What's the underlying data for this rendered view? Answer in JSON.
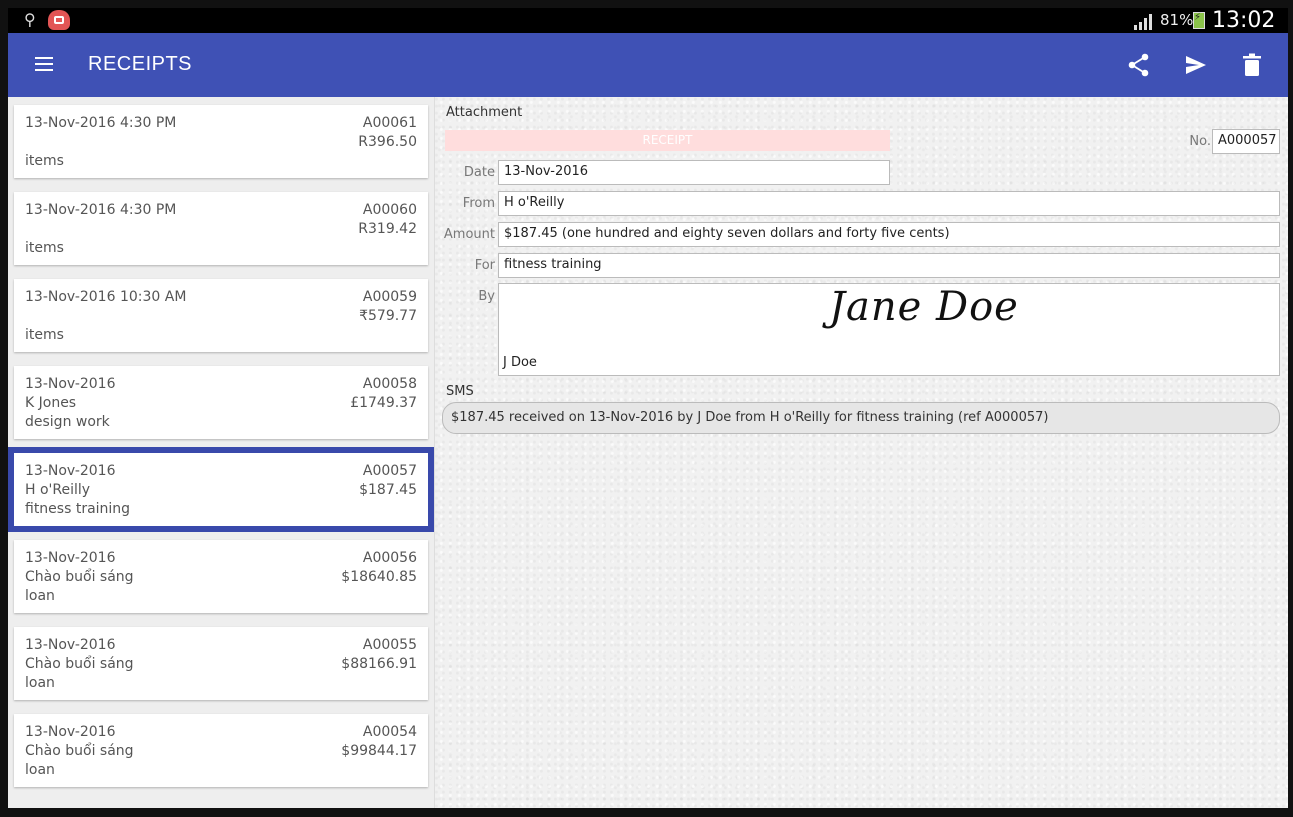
{
  "status_bar": {
    "battery_pct": "81%",
    "time": "13:02"
  },
  "app_bar": {
    "title": "RECEIPTS",
    "actions": [
      "share-icon",
      "send-icon",
      "delete-icon"
    ]
  },
  "receipts": [
    {
      "line1": "13-Nov-2016  4:30 PM",
      "line2": "",
      "line3": "items",
      "ref": "A00061",
      "amount": "R396.50"
    },
    {
      "line1": "13-Nov-2016  4:30 PM",
      "line2": "",
      "line3": "items",
      "ref": "A00060",
      "amount": "R319.42"
    },
    {
      "line1": "13-Nov-2016  10:30 AM",
      "line2": "",
      "line3": "items",
      "ref": "A00059",
      "amount": "₹579.77"
    },
    {
      "line1": "13-Nov-2016",
      "line2": "K Jones",
      "line3": "design work",
      "ref": "A00058",
      "amount": "£1749.37"
    },
    {
      "line1": "13-Nov-2016",
      "line2": "H o'Reilly",
      "line3": "fitness training",
      "ref": "A00057",
      "amount": "$187.45",
      "selected": true
    },
    {
      "line1": "13-Nov-2016",
      "line2": "Chào buổi sáng",
      "line3": "loan",
      "ref": "A00056",
      "amount": "$18640.85"
    },
    {
      "line1": "13-Nov-2016",
      "line2": "Chào buổi sáng",
      "line3": "loan",
      "ref": "A00055",
      "amount": "$88166.91"
    },
    {
      "line1": "13-Nov-2016",
      "line2": "Chào buổi sáng",
      "line3": "loan",
      "ref": "A00054",
      "amount": "$99844.17"
    }
  ],
  "detail": {
    "attachment_label": "Attachment",
    "banner": "RECEIPT",
    "no_label": "No.",
    "no_value": "A000057",
    "date_label": "Date",
    "date_value": "13-Nov-2016",
    "from_label": "From",
    "from_value": "H o'Reilly",
    "amount_label": "Amount",
    "amount_value": "$187.45 (one hundred and eighty seven dollars and forty five cents)",
    "for_label": "For",
    "for_value": "fitness training",
    "by_label": "By",
    "signature_script": "Jane Doe",
    "signature_name": "J Doe",
    "sms_label": "SMS",
    "sms_text": "$187.45 received on 13-Nov-2016 by J Doe from H o'Reilly for fitness training (ref A000057)"
  },
  "colors": {
    "primary": "#3f51b5",
    "selected_outline": "#3949ab",
    "banner": "#ffdddd"
  }
}
